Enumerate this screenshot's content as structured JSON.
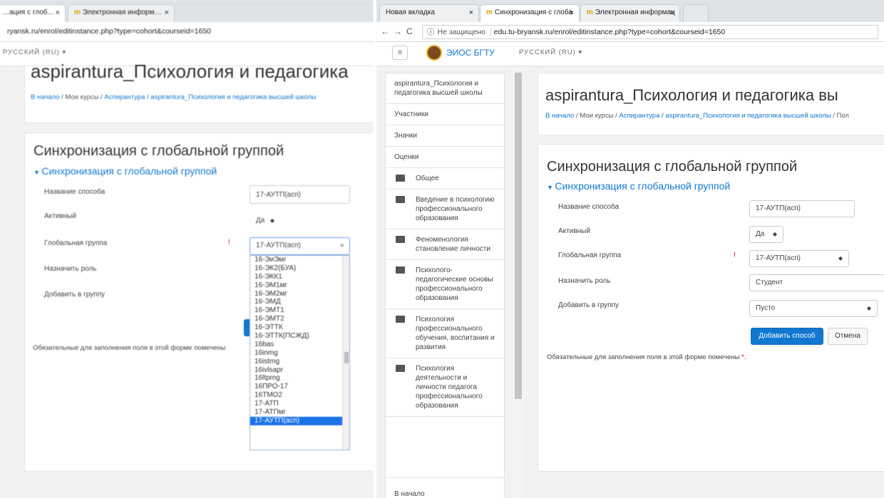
{
  "left": {
    "tabs": [
      {
        "label": "…ация с глоб…"
      },
      {
        "label": "Электронная информ…"
      }
    ],
    "url": "ryansk.ru/enrol/editinstance.php?type=cohort&courseid=1650",
    "lang": "РУССКИЙ (RU) ▾",
    "course_title": "aspirantura_Психология и педагогика",
    "breadcrumb": {
      "home": "В начало",
      "my": "Мои курсы",
      "cat": "Аспирантура",
      "course": "aspirantura_Психология и педагогика высшей школы"
    },
    "page_heading": "Синхронизация с глобальной группой",
    "legend": "Синхронизация с глобальной группой",
    "form": {
      "name_label": "Название способа",
      "name_value": "17-АУТП(асп)",
      "active_label": "Активный",
      "active_value": "Да",
      "group_label": "Глобальная группа",
      "group_value": "17-АУТП(асп)",
      "role_label": "Назначить роль",
      "addgroup_label": "Добавить в группу"
    },
    "required_note": "Обязательные для заполнения поля в этой форме помечены",
    "dropdown_options": [
      "16-ЭиЭмг",
      "16-ЭК2(БУА)",
      "16-ЭКК1",
      "16-ЭМ1мг",
      "16-ЭМ2мг",
      "16-ЭМД",
      "16-ЭМТ1",
      "16-ЭМТ2",
      "16-ЭТТК",
      "16-ЭТТК(ПСЖД)",
      "16bas",
      "16inmg",
      "16istmg",
      "16ivlsapr",
      "16ltpmg",
      "16ПРО-17",
      "16ТМО2",
      "17-АТП",
      "17-АТПмг",
      "17-АУТП(асп)"
    ],
    "dropdown_selected": "17-АУТП(асп)"
  },
  "right": {
    "tabs": [
      {
        "label": "Новая вкладка"
      },
      {
        "label": "Синхронизация с глоба"
      },
      {
        "label": "Электронная информац"
      }
    ],
    "url_security": "Не защищено",
    "url": "edu.tu-bryansk.ru/enrol/editinstance.php?type=cohort&courseid=1650",
    "brand": "ЭИОС БГТУ",
    "lang": "РУССКИЙ (RU) ▾",
    "drawer": [
      {
        "label": "aspirantura_Психология и педагогика высшей школы",
        "folder": false
      },
      {
        "label": "Участники",
        "folder": false
      },
      {
        "label": "Значки",
        "folder": false
      },
      {
        "label": "Оценки",
        "folder": false
      },
      {
        "label": "Общее",
        "folder": true
      },
      {
        "label": "Введение в психологию профессионального образования",
        "folder": true
      },
      {
        "label": "Феноменология становление личности",
        "folder": true
      },
      {
        "label": "Психолого-педагогические основы профессионального образования",
        "folder": true
      },
      {
        "label": "Психология профессионального обучения, воспитания и развития",
        "folder": true
      },
      {
        "label": "Психология деятельности и личности педагога профессионального образования",
        "folder": true
      }
    ],
    "drawer_home": "В начало",
    "course_title": "aspirantura_Психология и педагогика вы",
    "breadcrumb": {
      "home": "В начало",
      "my": "Мои курсы",
      "cat": "Аспирантура",
      "course": "aspirantura_Психология и педагогика высшей школы",
      "last": "Пол"
    },
    "page_heading": "Синхронизация с глобальной группой",
    "legend": "Синхронизация с глобальной группой",
    "form": {
      "name_label": "Название способа",
      "name_value": "17-АУТП(асп)",
      "active_label": "Активный",
      "active_value": "Да",
      "group_label": "Глобальная группа",
      "group_value": "17-АУТП(асп)",
      "role_label": "Назначить роль",
      "role_value": "Студент",
      "addgroup_label": "Добавить в группу",
      "addgroup_value": "Пусто"
    },
    "submit_label": "Добавить способ",
    "cancel_label": "Отмена",
    "required_note": "Обязательные для заполнения поля в этой форме помечены"
  }
}
